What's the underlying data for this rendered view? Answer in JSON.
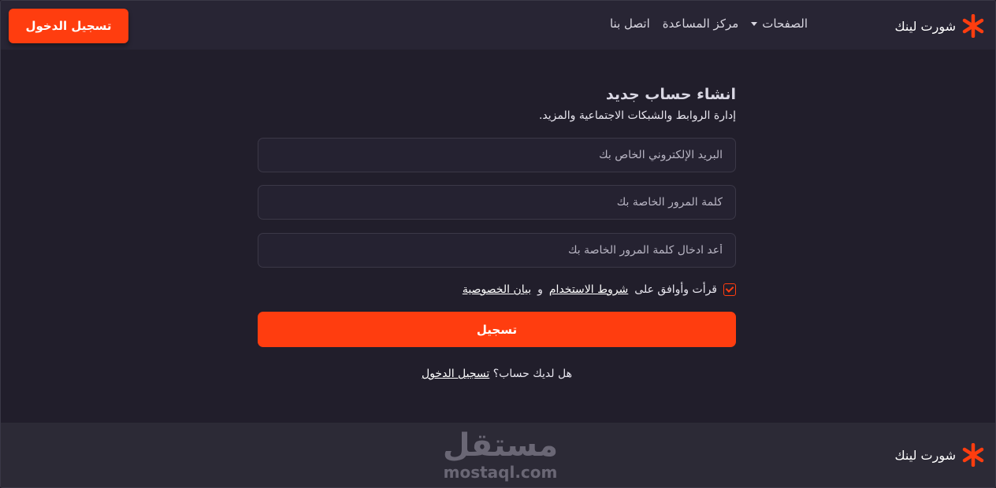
{
  "header": {
    "brand": "شورت لينك",
    "nav": [
      "الصفحات",
      "مركز المساعدة",
      "اتصل بنا"
    ],
    "login_button": "تسجيل الدخول"
  },
  "form": {
    "title": "انشاء حساب جديد",
    "subtitle": "إدارة الروابط والشبكات الاجتماعية والمزيد.",
    "email_placeholder": "البريد الإلكتروني الخاص بك",
    "password_placeholder": "كلمة المرور الخاصة بك",
    "confirm_placeholder": "أعد ادخال كلمة المرور الخاصة بك",
    "terms_prefix": "قرأت وأوافق على",
    "terms_link": "شروط الاستخدام",
    "terms_and": "و",
    "privacy_link": "بيان الخصوصية",
    "terms_checked": true,
    "submit": "تسجيل",
    "have_account": "هل لديك حساب؟",
    "login_link": "تسجيل الدخول"
  },
  "footer": {
    "brand": "شورت لينك",
    "watermark_ar": "مستقل",
    "watermark_en": "mostaql.com"
  },
  "colors": {
    "accent": "#ff3d0f",
    "background": "#211e2b",
    "header": "#282534",
    "footer": "#2c2a36"
  },
  "icons": {
    "brand_icon": "asterisk-logo-icon",
    "dropdown": "caret-down-icon",
    "checkbox": "checkmark-icon"
  }
}
